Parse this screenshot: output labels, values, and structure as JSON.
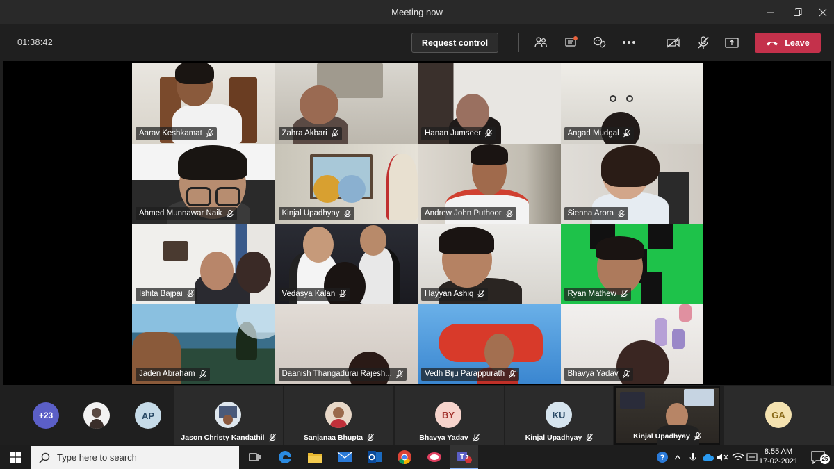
{
  "window": {
    "title": "Meeting now"
  },
  "toolbar": {
    "timer": "01:38:42",
    "request_control_label": "Request control",
    "leave_label": "Leave"
  },
  "tiles": [
    {
      "name": "Aarav Keshkamat"
    },
    {
      "name": "Zahra Akbari"
    },
    {
      "name": "Hanan Jumseer"
    },
    {
      "name": "Angad Mudgal"
    },
    {
      "name": "Ahmed Munnawar Naik"
    },
    {
      "name": "Kinjal Upadhyay"
    },
    {
      "name": "Andrew John Puthoor"
    },
    {
      "name": "Sienna Arora"
    },
    {
      "name": "Ishita Bajpai"
    },
    {
      "name": "Vedasya Kalan"
    },
    {
      "name": "Hayyan Ashiq"
    },
    {
      "name": "Ryan Mathew"
    },
    {
      "name": "Jaden Abraham"
    },
    {
      "name": "Daanish Thangadurai Rajesh..."
    },
    {
      "name": "Vedh Biju Parappurath"
    },
    {
      "name": "Bhavya Yadav"
    }
  ],
  "strip": {
    "overflow_count": "+23",
    "initials_ap": "AP",
    "participants": [
      {
        "name": "Jason Christy Kandathil"
      },
      {
        "name": "Sanjanaa Bhupta"
      },
      {
        "name": "Bhavya Yadav",
        "initials": "BY"
      },
      {
        "name": "Kinjal Upadhyay",
        "initials": "KU"
      },
      {
        "name": "Kinjal Upadhyay"
      },
      {
        "initials": "GA"
      }
    ]
  },
  "taskbar": {
    "search_placeholder": "Type here to search",
    "time": "8:55 AM",
    "date": "17-02-2021",
    "notification_count": "25",
    "teams_badge": "7"
  }
}
